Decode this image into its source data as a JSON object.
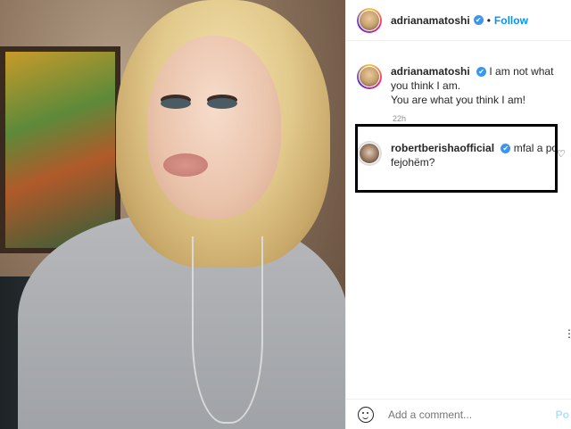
{
  "header": {
    "username": "adrianamatoshi",
    "verified_badge": "✔",
    "follow_label": "Follow"
  },
  "caption": {
    "username": "adrianamatoshi",
    "text_line1": "I am not what you think I am.",
    "text_line2": "You are what you think I am!",
    "time": "22h"
  },
  "comment": {
    "username": "robertberishaofficial",
    "text": "mfal a po fejohëm?"
  },
  "footer": {
    "placeholder": "Add a comment...",
    "post_label": "Po"
  },
  "icons": {
    "heart": "♡",
    "side_mark": "⋮"
  },
  "colors": {
    "accent": "#0095f6",
    "verified": "#3897f0"
  }
}
